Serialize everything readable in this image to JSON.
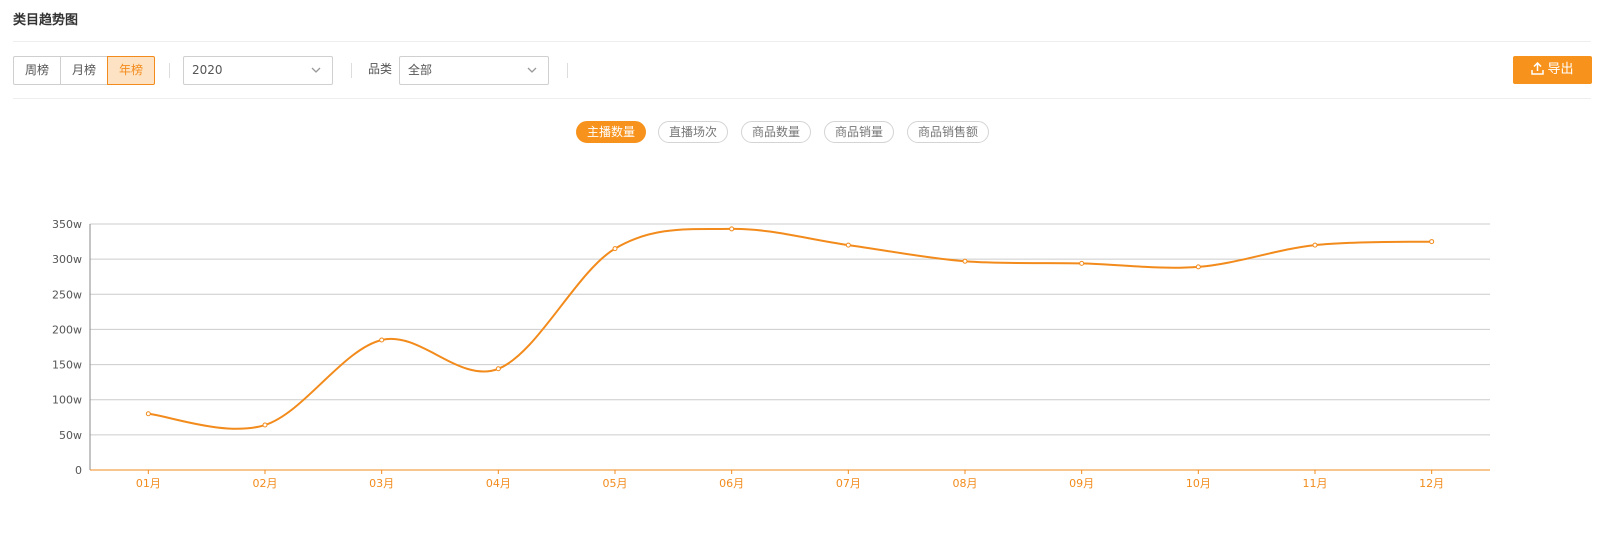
{
  "page": {
    "title": "类目趋势图"
  },
  "toolbar": {
    "period_tabs": [
      {
        "label": "周榜",
        "active": false
      },
      {
        "label": "月榜",
        "active": false
      },
      {
        "label": "年榜",
        "active": true
      }
    ],
    "year_select": {
      "value": "2020"
    },
    "category": {
      "label": "品类",
      "value": "全部"
    },
    "export_label": "导出"
  },
  "metrics": [
    {
      "label": "主播数量",
      "active": true
    },
    {
      "label": "直播场次",
      "active": false
    },
    {
      "label": "商品数量",
      "active": false
    },
    {
      "label": "商品销量",
      "active": false
    },
    {
      "label": "商品销售额",
      "active": false
    }
  ],
  "colors": {
    "accent": "#f7931d",
    "line": "#f28b1c",
    "grid": "#cccccc",
    "axis_label": "#555555"
  },
  "chart_data": {
    "type": "line",
    "categories": [
      "01月",
      "02月",
      "03月",
      "04月",
      "05月",
      "06月",
      "07月",
      "08月",
      "09月",
      "10月",
      "11月",
      "12月"
    ],
    "values": [
      80,
      64,
      185,
      144,
      315,
      343,
      320,
      297,
      294,
      289,
      320,
      325
    ],
    "y_unit": "w",
    "ylim": [
      0,
      350
    ],
    "yticks": [
      "0",
      "50w",
      "100w",
      "150w",
      "200w",
      "250w",
      "300w",
      "350w"
    ],
    "grid": true,
    "smooth": true,
    "title": "",
    "xlabel": "",
    "ylabel": ""
  }
}
